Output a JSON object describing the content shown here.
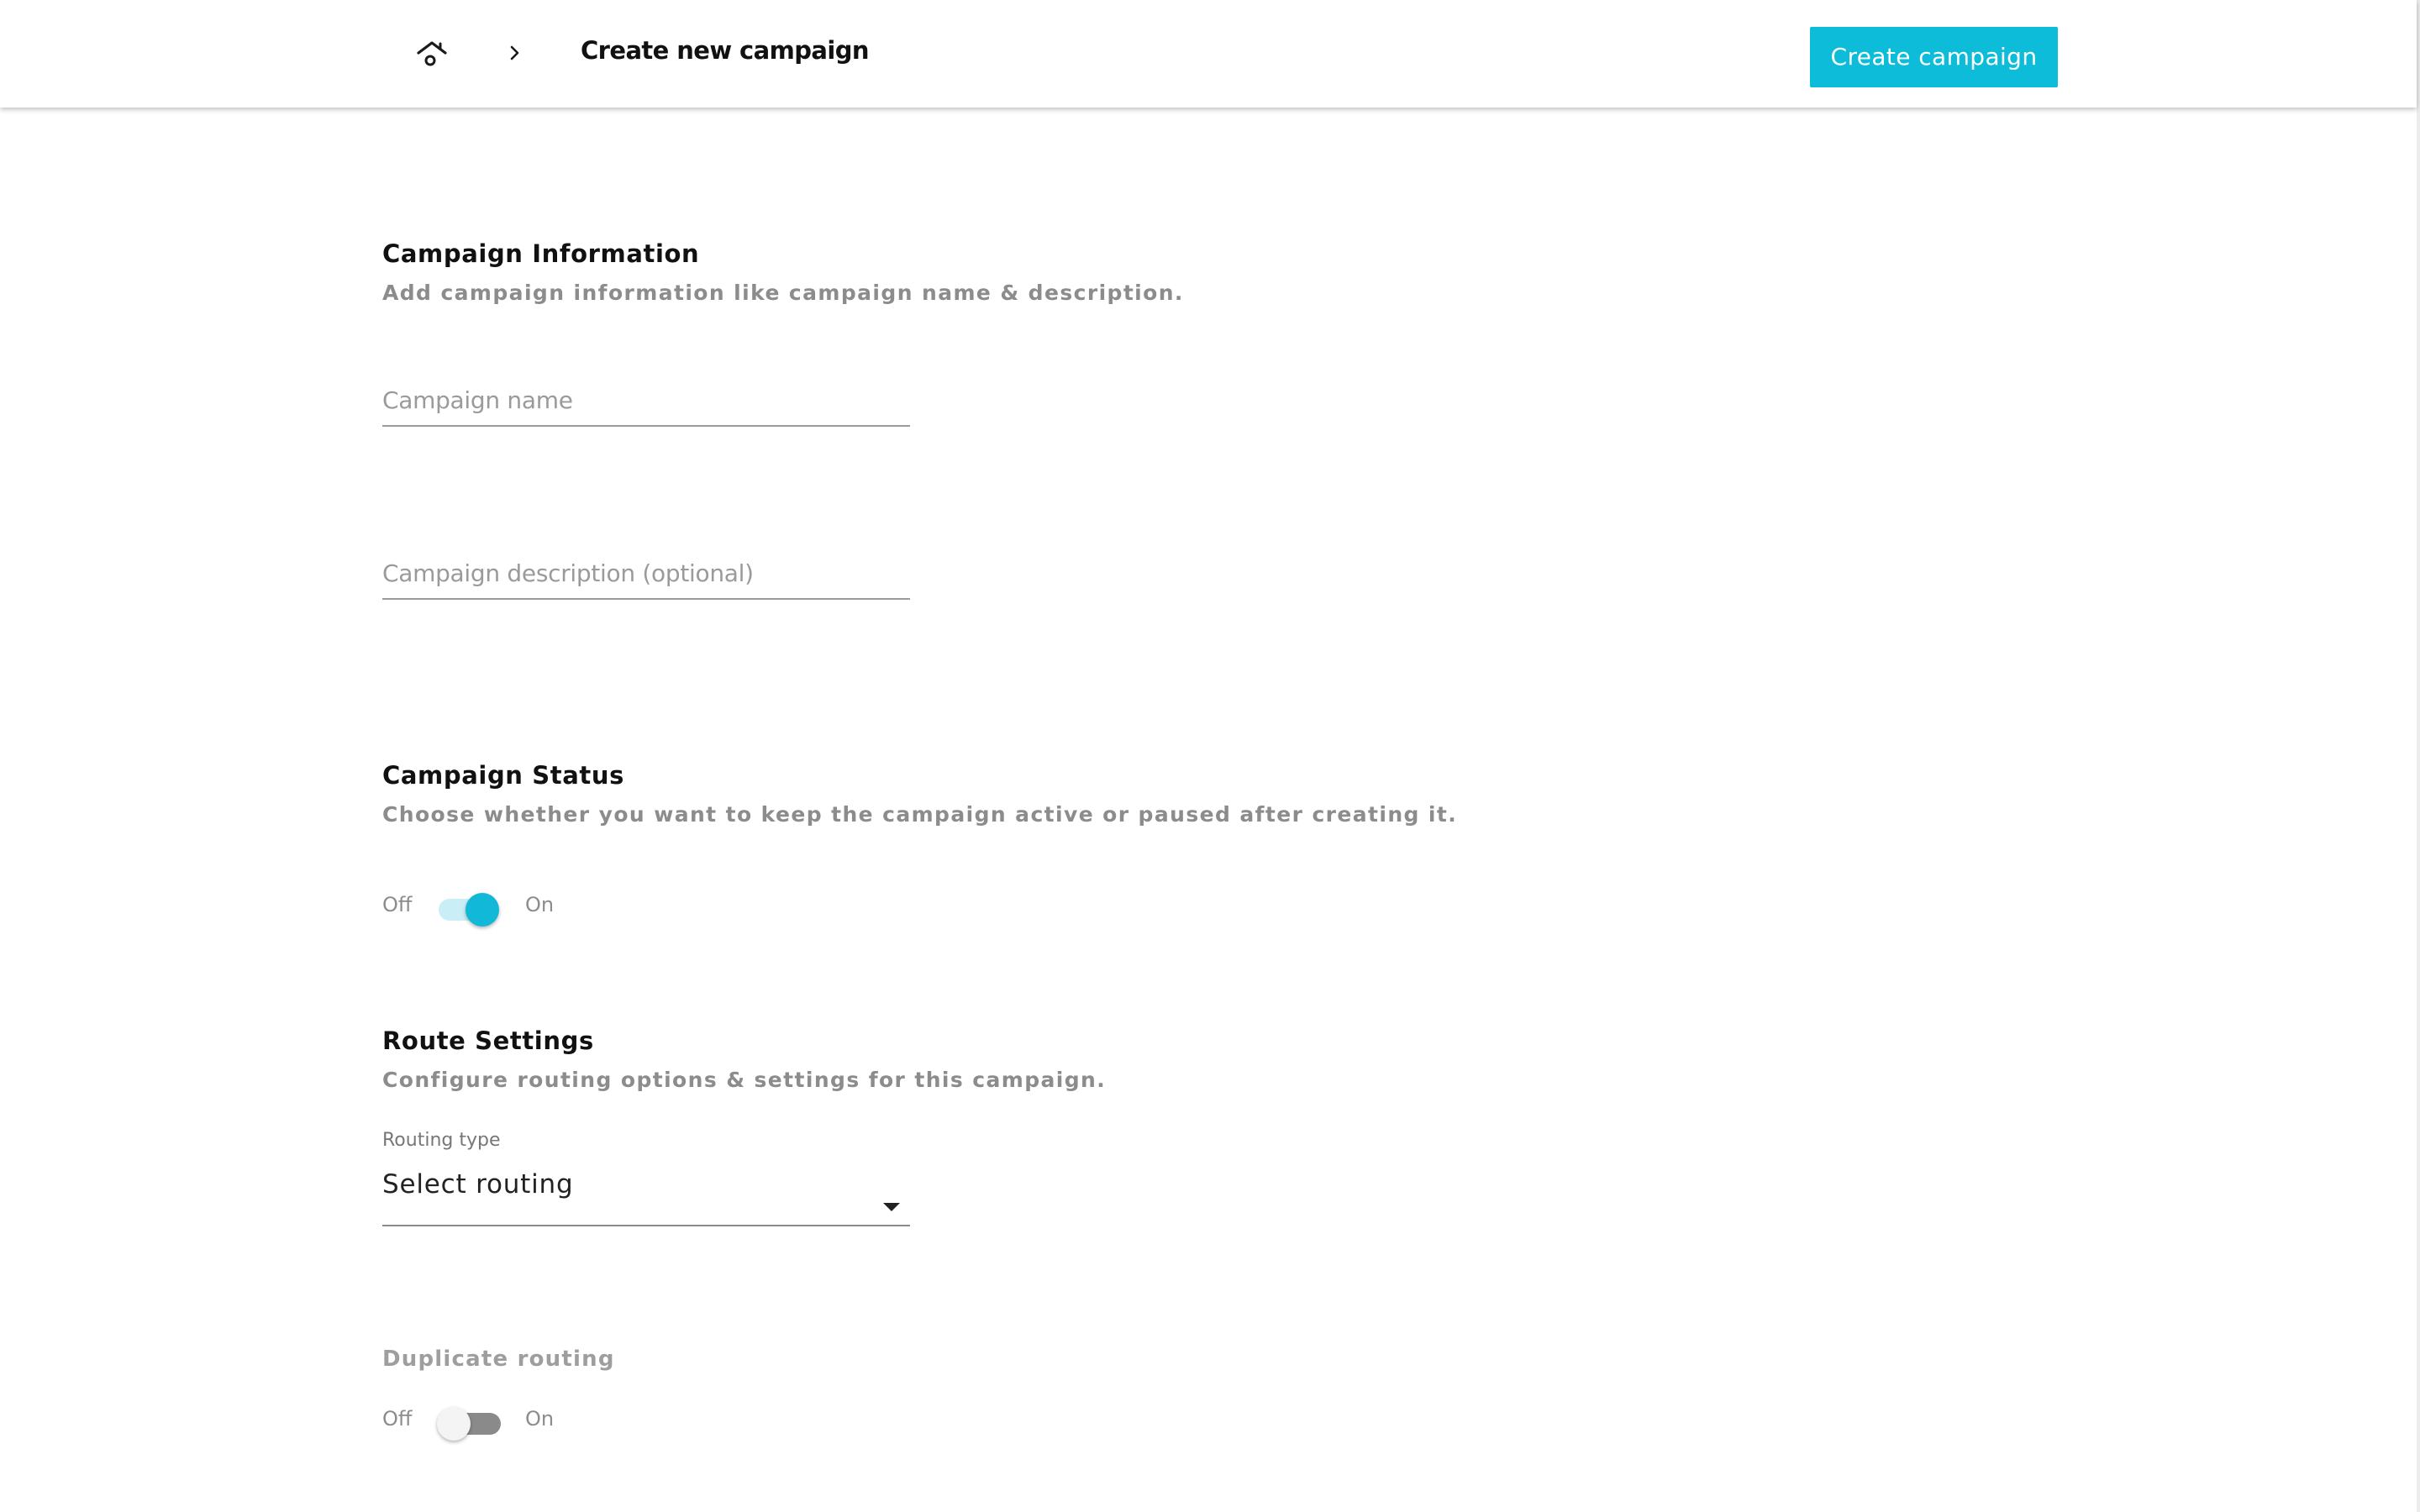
{
  "header": {
    "home_icon": "home-icon",
    "separator_icon": "chevron-right-icon",
    "title": "Create new campaign",
    "create_button_label": "Create campaign",
    "accent_color": "#0cbcd9"
  },
  "campaign_information": {
    "title": "Campaign Information",
    "description": "Add campaign information like campaign name & description.",
    "name_field": {
      "value": "",
      "placeholder": "Campaign name"
    },
    "description_field": {
      "value": "",
      "placeholder": "Campaign description (optional)"
    }
  },
  "campaign_status": {
    "title": "Campaign Status",
    "description": "Choose whether you want to keep the campaign active or paused after creating it.",
    "off_label": "Off",
    "on_label": "On",
    "enabled": true
  },
  "route_settings": {
    "title": "Route Settings",
    "description": "Configure routing options & settings for this campaign.",
    "routing_type_label": "Routing type",
    "routing_type_value": "Select routing",
    "duplicate_routing": {
      "title": "Duplicate routing",
      "off_label": "Off",
      "on_label": "On",
      "enabled": false
    }
  }
}
